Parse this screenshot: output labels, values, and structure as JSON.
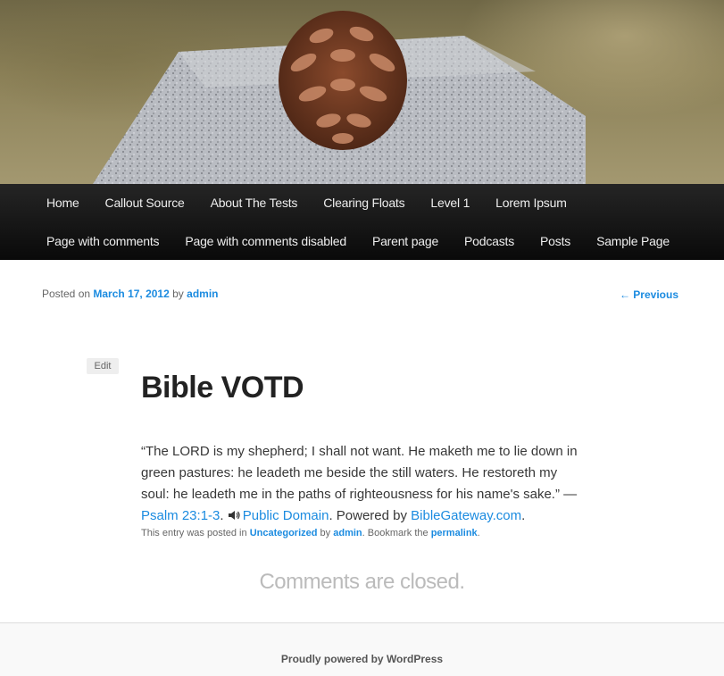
{
  "nav": {
    "row1": [
      "Home",
      "Callout Source",
      "About The Tests",
      "Clearing Floats",
      "Level 1",
      "Lorem Ipsum"
    ],
    "row2": [
      "Page with comments",
      "Page with comments disabled",
      "Parent page",
      "Podcasts",
      "Posts",
      "Sample Page"
    ]
  },
  "post": {
    "posted_prefix": "Posted on",
    "date": "March 17, 2012",
    "by": "by",
    "author": "admin",
    "previous": "← Previous",
    "edit": "Edit",
    "title": "Bible VOTD",
    "quote": "“The LORD is my shepherd; I shall not want. He maketh me to lie down in green pastures: he leadeth me beside the still waters. He restoreth my soul: he leadeth me in the paths of righteousness for his name's sake.” — ",
    "ref_link": "Psalm 23:1-3",
    "after_ref": ". ",
    "speaker_icon": "speaker-icon",
    "license_link": "Public Domain",
    "powered_text": ". Powered by ",
    "gateway_link": "BibleGateway.com",
    "end": ".",
    "meta_prefix": "This entry was posted in",
    "category": "Uncategorized",
    "meta_by": "by",
    "meta_author": "admin",
    "meta_bookmark": ". Bookmark the",
    "permalink": "permalink",
    "meta_end": "."
  },
  "comments_closed": "Comments are closed.",
  "footer": {
    "powered": "Proudly powered by WordPress"
  },
  "colors": {
    "link": "#1b8be0",
    "nav_bg": "#111111",
    "nav_text": "#eeeeee"
  }
}
